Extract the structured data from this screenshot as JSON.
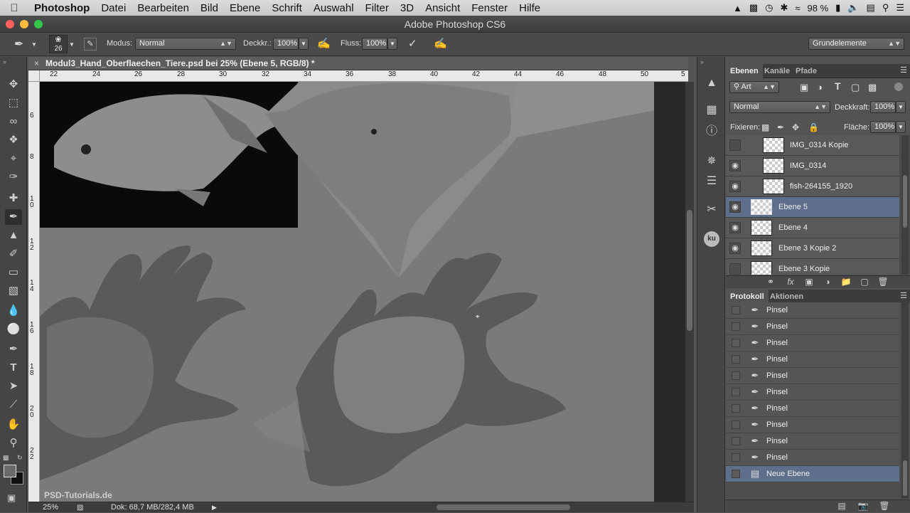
{
  "menubar": {
    "app_name": "Photoshop",
    "items": [
      "Datei",
      "Bearbeiten",
      "Bild",
      "Ebene",
      "Schrift",
      "Auswahl",
      "Filter",
      "3D",
      "Ansicht",
      "Fenster",
      "Hilfe"
    ],
    "battery": "98 %"
  },
  "window": {
    "title": "Adobe Photoshop CS6"
  },
  "options": {
    "brush_size": "26",
    "mode_label": "Modus:",
    "mode_value": "Normal",
    "opacity_label": "Deckkr.:",
    "opacity_value": "100%",
    "flow_label": "Fluss:",
    "flow_value": "100%",
    "workspace": "Grundelemente"
  },
  "document": {
    "tab_title": "Modul3_Hand_Oberflaechen_Tiere.psd bei 25% (Ebene 5, RGB/8) *",
    "ruler_top": [
      "22",
      "24",
      "26",
      "28",
      "30",
      "32",
      "34",
      "36",
      "38",
      "40",
      "42",
      "44",
      "46",
      "48",
      "50",
      "5"
    ],
    "ruler_left": [
      "6",
      "8",
      "1 0",
      "1 2",
      "1 4",
      "1 6",
      "1 8",
      "2 0",
      "2 2"
    ],
    "zoom": "25%",
    "doc_info": "Dok: 68,7 MB/282,4 MB",
    "watermark": "PSD-Tutorials.de"
  },
  "layers_panel": {
    "tabs": [
      "Ebenen",
      "Kanäle",
      "Pfade"
    ],
    "filter_kind": "Art",
    "blend_mode": "Normal",
    "opacity_label": "Deckkraft:",
    "opacity_value": "100%",
    "lock_label": "Fixieren:",
    "fill_label": "Fläche:",
    "fill_value": "100%",
    "layers": [
      {
        "name": "IMG_0314 Kopie",
        "visible": false,
        "selected": false
      },
      {
        "name": "IMG_0314",
        "visible": true,
        "selected": false
      },
      {
        "name": "fish-264155_1920",
        "visible": true,
        "selected": false
      },
      {
        "name": "Ebene 5",
        "visible": true,
        "selected": true
      },
      {
        "name": "Ebene 4",
        "visible": true,
        "selected": false
      },
      {
        "name": "Ebene 3 Kopie 2",
        "visible": true,
        "selected": false
      },
      {
        "name": "Ebene 3 Kopie",
        "visible": false,
        "selected": false
      }
    ]
  },
  "history_panel": {
    "tabs": [
      "Protokoll",
      "Aktionen"
    ],
    "items": [
      "Pinsel",
      "Pinsel",
      "Pinsel",
      "Pinsel",
      "Pinsel",
      "Pinsel",
      "Pinsel",
      "Pinsel",
      "Pinsel",
      "Pinsel",
      "Neue Ebene"
    ],
    "selected_index": 10
  },
  "colors": {
    "selection_blue": "#5f6f8b",
    "panel_bg": "#535353"
  }
}
